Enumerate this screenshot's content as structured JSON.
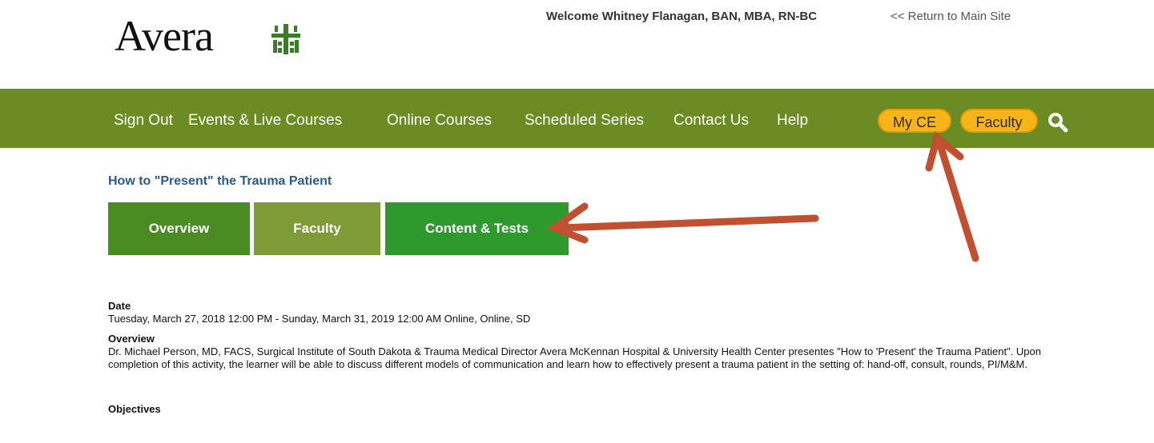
{
  "header": {
    "logo_text": "Avera",
    "welcome": "Welcome Whitney Flanagan, BAN, MBA, RN-BC",
    "return_link": "<< Return to Main Site"
  },
  "nav": {
    "items": [
      "Sign Out",
      "Events & Live Courses",
      "Online Courses",
      "Scheduled Series",
      "Contact Us",
      "Help"
    ],
    "my_ce": "My CE",
    "faculty": "Faculty",
    "search_icon": "search-icon"
  },
  "course": {
    "title": "How to \"Present\" the Trauma Patient",
    "tabs": [
      "Overview",
      "Faculty",
      "Content & Tests"
    ]
  },
  "details": {
    "date_heading": "Date",
    "date_text": "Tuesday, March 27, 2018 12:00 PM - Sunday, March 31, 2019 12:00 AM   Online, Online, SD",
    "overview_heading": "Overview",
    "overview_text": "Dr. Michael Person, MD, FACS, Surgical Institute of South Dakota & Trauma Medical Director Avera McKennan Hospital & University Health Center presentes \"How to 'Present' the Trauma Patient\". Upon completion of this activity, the learner will be able to discuss different models of communication and learn how to effectively present a trauma patient in the setting of: hand-off, consult, rounds, PI/M&M.",
    "objectives_heading": "Objectives"
  },
  "colors": {
    "nav_green": "#6a8c23",
    "pill_yellow": "#f7b51a",
    "arrow_red": "#c0502f",
    "title_blue": "#2a5a8c"
  }
}
